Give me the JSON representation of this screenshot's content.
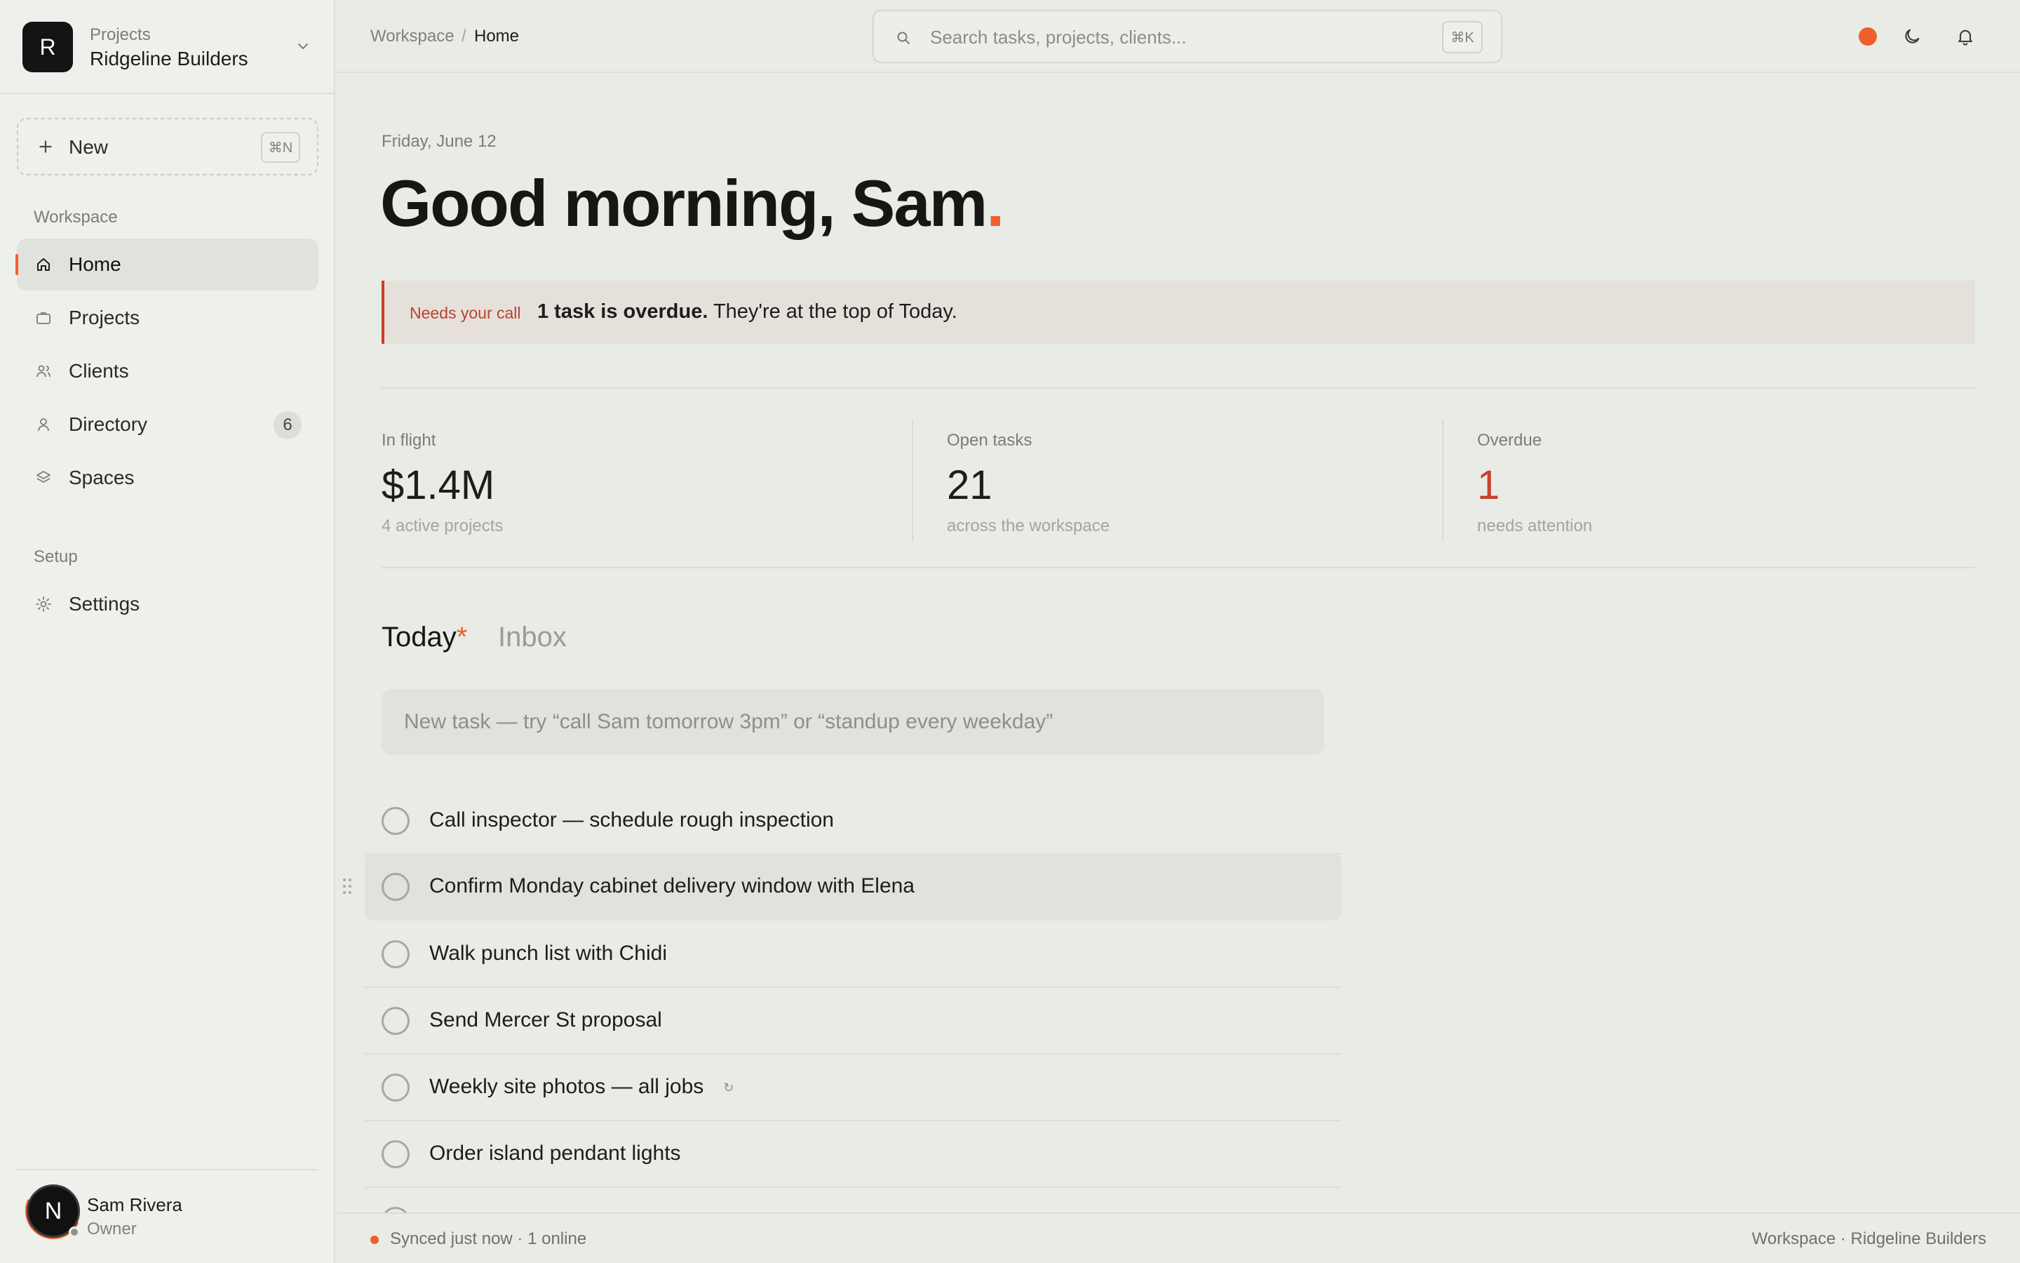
{
  "sidebar": {
    "workspace": {
      "initial": "R",
      "kicker": "Projects",
      "name": "Ridgeline Builders"
    },
    "new_button": {
      "label": "New",
      "shortcut": "⌘N"
    },
    "sections": {
      "workspace": "Workspace",
      "setup": "Setup"
    },
    "nav": {
      "home": {
        "label": "Home",
        "icon": "home-icon"
      },
      "projects": {
        "label": "Projects",
        "icon": "briefcase-icon"
      },
      "clients": {
        "label": "Clients",
        "icon": "users-icon"
      },
      "directory": {
        "label": "Directory",
        "icon": "person-icon",
        "badge": "6"
      },
      "spaces": {
        "label": "Spaces",
        "icon": "layers-icon"
      },
      "settings": {
        "label": "Settings",
        "icon": "sun-gear-icon"
      }
    },
    "user": {
      "initial": "N",
      "name": "Sam Rivera",
      "role": "Owner"
    }
  },
  "topbar": {
    "breadcrumb": {
      "root": "Workspace",
      "separator": "/",
      "current": "Home"
    },
    "search": {
      "placeholder": "Search tasks, projects, clients...",
      "shortcut": "⌘K"
    },
    "icons": [
      "status-dot-icon",
      "moon-icon",
      "bell-icon"
    ]
  },
  "main": {
    "date": "Friday, June 12",
    "greeting": "Good morning, Sam",
    "greeting_punct": ".",
    "alert": {
      "tag": "Needs your call",
      "bold": "1 task is overdue.",
      "rest": " They're at the top of Today."
    },
    "stats": {
      "in_flight": {
        "label": "In flight",
        "value": "$1.4M",
        "sub": "4 active projects"
      },
      "open_tasks": {
        "label": "Open tasks",
        "value": "21",
        "sub": "across the workspace"
      },
      "overdue": {
        "label": "Overdue",
        "value": "1",
        "sub": "needs attention"
      }
    },
    "tabs": {
      "today": "Today",
      "today_marker": "*",
      "inbox": "Inbox"
    },
    "task_input_placeholder": "New task — try “call Sam tomorrow 3pm” or “standup every weekday”",
    "tasks": [
      {
        "title": "Call inspector — schedule rough inspection"
      },
      {
        "title": "Confirm Monday cabinet delivery window with Elena"
      },
      {
        "title": "Walk punch list with Chidi"
      },
      {
        "title": "Send Mercer St proposal"
      },
      {
        "title": "Weekly site photos — all jobs",
        "repeat_icon": "↻"
      },
      {
        "title": "Order island pendant lights"
      }
    ]
  },
  "footer": {
    "sync": "Synced just now · 1 online",
    "context": "Workspace · Ridgeline Builders"
  },
  "colors": {
    "accent": "#f0602b",
    "danger": "#c8402b",
    "background": "#e8ebe6",
    "sidebar": "#eef0ec"
  }
}
